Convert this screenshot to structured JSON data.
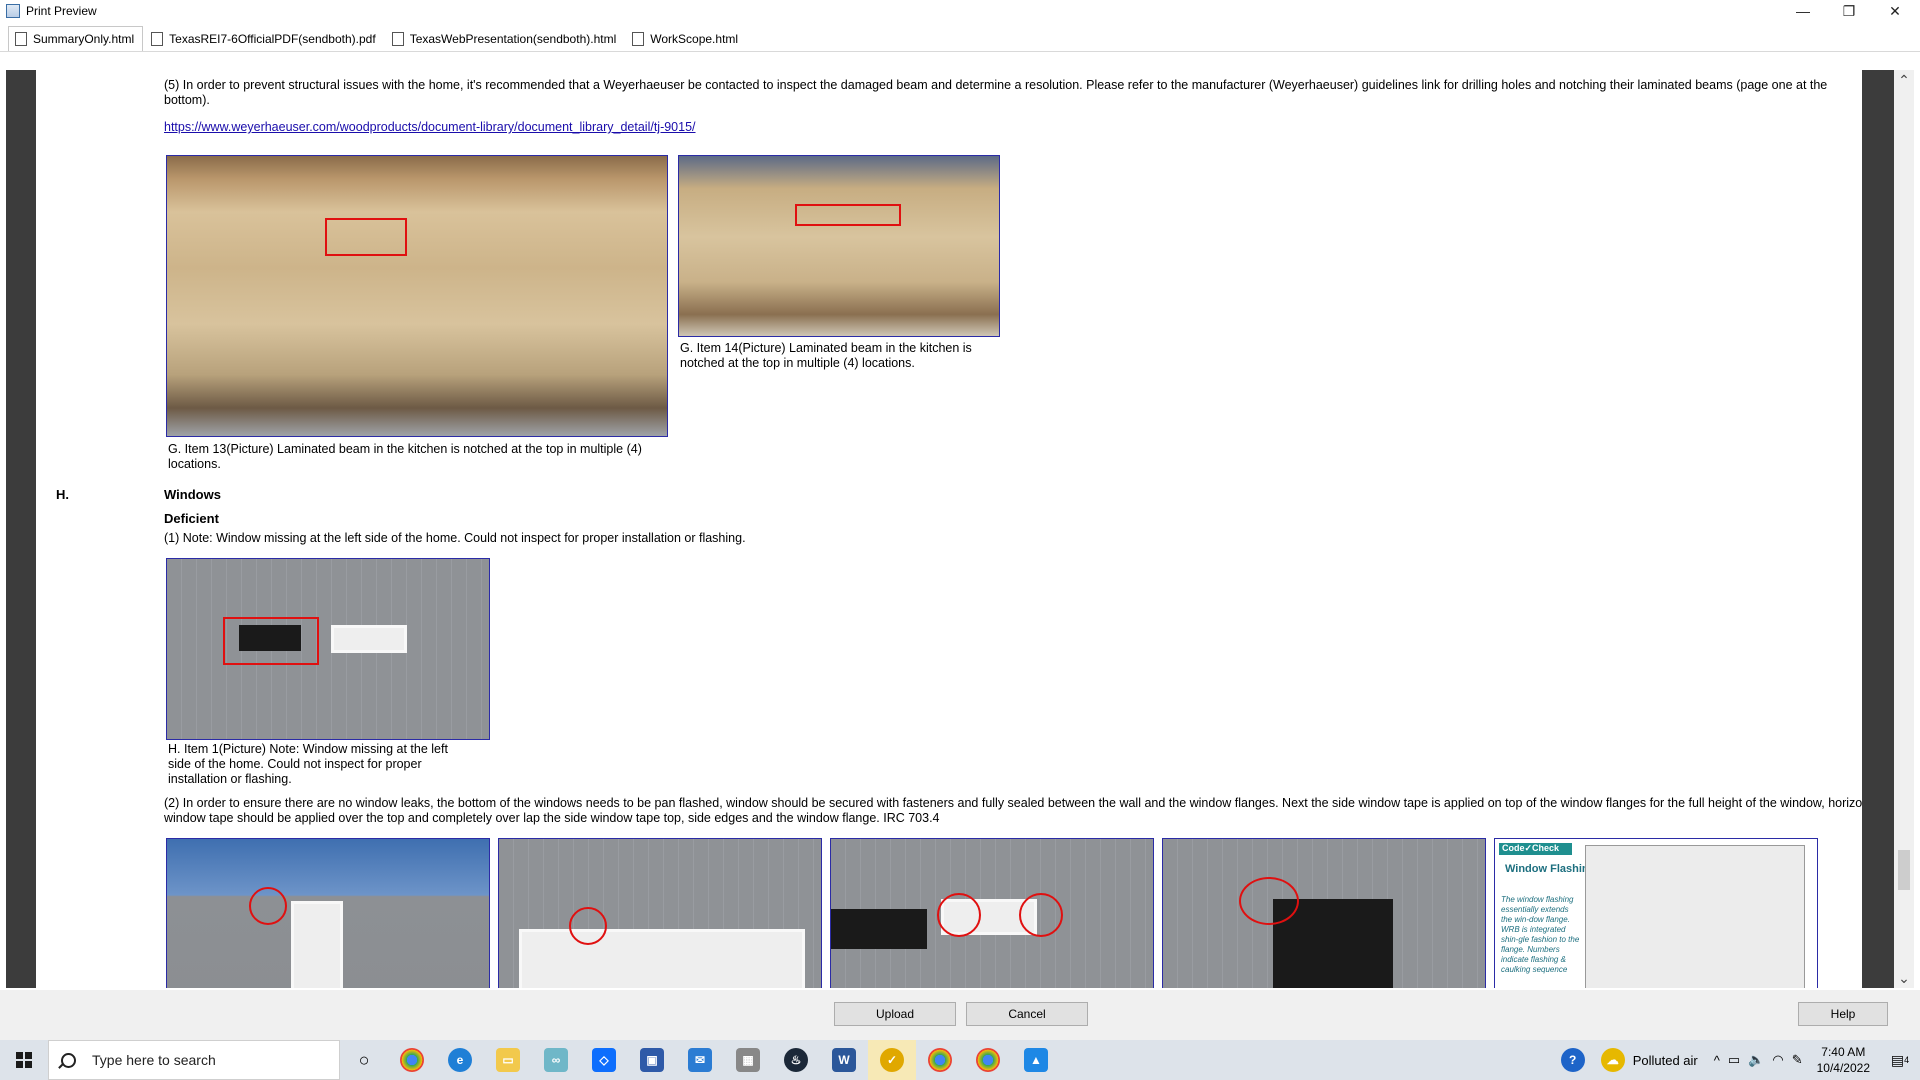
{
  "window": {
    "title": "Print Preview",
    "minimize_glyph": "—",
    "restore_glyph": "❐",
    "close_glyph": "✕"
  },
  "tabs": [
    {
      "label": "SummaryOnly.html",
      "active": true
    },
    {
      "label": "TexasREI7-6OfficialPDF(sendboth).pdf",
      "active": false
    },
    {
      "label": "TexasWebPresentation(sendboth).html",
      "active": false
    },
    {
      "label": "WorkScope.html",
      "active": false
    }
  ],
  "content": {
    "para5": "(5) In order to prevent structural issues with the home, it's recommended that a Weyerhaeuser be contacted to inspect the damaged beam and determine a resolution. Please refer to the manufacturer (Weyerhaeuser) guidelines link for drilling holes and notching their laminated beams (page one at the bottom).",
    "link": "https://www.weyerhaeuser.com/woodproducts/document-library/document_library_detail/tj-9015/",
    "caption_g13": "G. Item 13(Picture) Laminated beam in the kitchen is notched at the top in multiple (4) locations.",
    "caption_g14": "G. Item 14(Picture) Laminated beam in the kitchen is notched at the top in multiple (4) locations.",
    "section_letter": "H.",
    "section_title": "Windows",
    "status": "Deficient",
    "note1": "(1) Note: Window missing at the left side of the home. Could not inspect for proper installation or flashing.",
    "caption_h1": "H. Item 1(Picture) Note: Window missing at the left side of the home. Could not inspect for proper installation or flashing.",
    "para2": "(2) In order to ensure there are no window leaks, the bottom of the windows needs to be pan flashed, window should be secured with fasteners and fully sealed between the wall and the window flanges. Next the side window tape is applied on top of the window flanges for the full height of the window, horizontal window tape should be applied over the top and completely over lap the side window tape top, side edges and the window flange. IRC 703.4",
    "diagram": {
      "badge": "Code✓Check",
      "title": "Window Flashing",
      "body": "The window flashing essentially extends the win-dow flange. WRB is integrated shin-gle fashion to the flange. Numbers indicate flashing & caulking sequence"
    }
  },
  "buttons": {
    "upload": "Upload",
    "cancel": "Cancel",
    "help": "Help"
  },
  "taskbar": {
    "search_placeholder": "Type here to search",
    "air_quality": "Polluted air",
    "time": "7:40 AM",
    "date": "10/4/2022",
    "notification_count": "4"
  }
}
